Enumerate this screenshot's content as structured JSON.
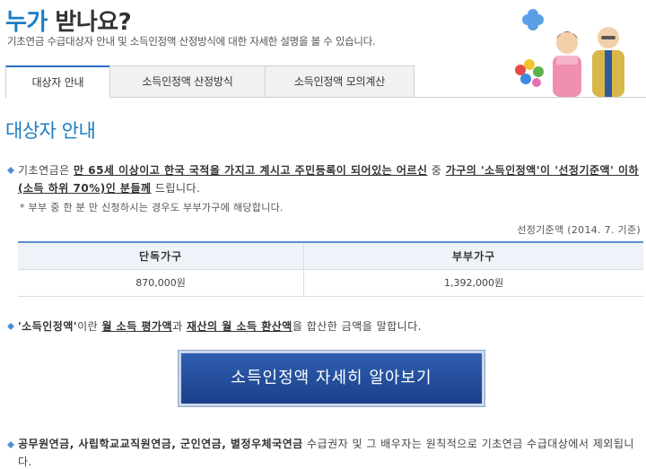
{
  "header": {
    "title_accent": "누가",
    "title_rest": " 받나요?",
    "description": "기초연금 수급대상자 안내 및 소득인정액 산정방식에 대한 자세한 설명을 볼 수 있습니다."
  },
  "tabs": [
    {
      "label": "대상자 안내",
      "active": true
    },
    {
      "label": "소득인정액 산정방식",
      "active": false
    },
    {
      "label": "소득인정액 모의계산",
      "active": false
    }
  ],
  "section_title": "대상자 안내",
  "eligibility": {
    "prefix": "기초연금은 ",
    "bold1": "만 65세 이상이고 한국 국적을 가지고 계시고 주민등록이 되어있는 어르신",
    "mid": " 중 ",
    "bold2": "가구의 '소득인정액'이 '선정기준액' 이하(소득 하위 70%)인 분들께",
    "suffix": " 드립니다."
  },
  "note": "* 부부 중 한 분 만 신청하시는 경우도 부부가구에 해당합니다.",
  "standard_label": "선정기준액 (2014. 7. 기준)",
  "income_table": {
    "headers": [
      "단독가구",
      "부부가구"
    ],
    "values": [
      "870,000원",
      "1,392,000원"
    ]
  },
  "definition": {
    "bold1": "'소득인정액'",
    "text1": "이란 ",
    "bold2": "월 소득 평가액",
    "text2": "과 ",
    "bold3": "재산의 월 소득 환산액",
    "text3": "을 합산한 금액을 말합니다."
  },
  "cta_button": "소득인정액 자세히 알아보기",
  "exclusion": {
    "bold": "공무원연금, 사립학교교직원연금, 군인연금, 별정우체국연금",
    "text": " 수급권자 및 그 배우자는 원칙적으로 기초연금 수급대상에서 제외됩니다."
  },
  "colors": {
    "accent": "#1a7dc4",
    "button": "#2a4f9c",
    "bullet": "#4a8fd4"
  }
}
